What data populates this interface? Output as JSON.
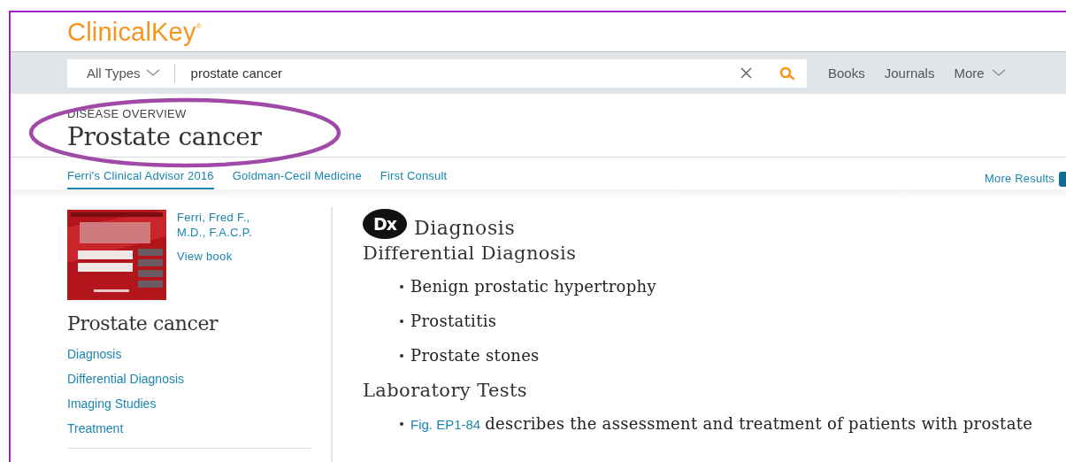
{
  "header": {
    "logo": "ClinicalKey",
    "logo_mark": "®"
  },
  "search": {
    "type_filter": "All Types",
    "value": "prostate cancer"
  },
  "nav": [
    {
      "label": "Books",
      "dropdown": false
    },
    {
      "label": "Journals",
      "dropdown": false
    },
    {
      "label": "More",
      "dropdown": true
    }
  ],
  "overview": {
    "label": "DISEASE OVERVIEW",
    "title": "Prostate cancer"
  },
  "tabs": [
    {
      "label": "Ferri's Clinical Advisor 2016",
      "selected": true
    },
    {
      "label": "Goldman-Cecil Medicine",
      "selected": false
    },
    {
      "label": "First Consult",
      "selected": false
    }
  ],
  "more_results": "More Results",
  "book": {
    "author": "Ferri, Fred F., M.D., F.A.C.P.",
    "view_link": "View book"
  },
  "toc": {
    "title": "Prostate cancer",
    "items": [
      "Diagnosis",
      "Differential Diagnosis",
      "Imaging Studies",
      "Treatment"
    ]
  },
  "article": {
    "badge": "Dx",
    "heading": "Diagnosis",
    "sections": [
      {
        "title": "Differential Diagnosis",
        "items": [
          {
            "text": "Benign prostatic hypertrophy"
          },
          {
            "text": "Prostatitis"
          },
          {
            "text": "Prostate stones"
          }
        ]
      },
      {
        "title": "Laboratory Tests",
        "items": [
          {
            "link": "Fig. EP1-84",
            "text": "describes the assessment and treatment of patients with prostate"
          }
        ]
      }
    ]
  }
}
